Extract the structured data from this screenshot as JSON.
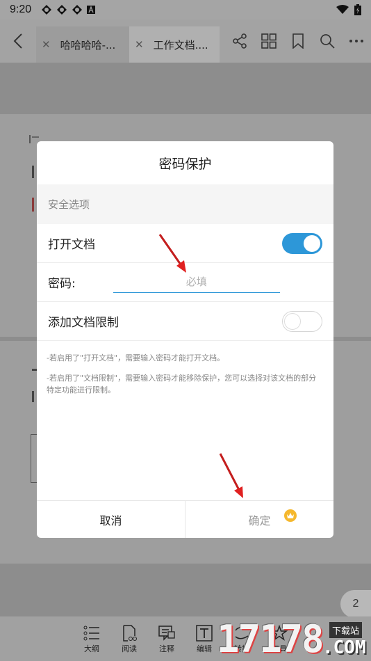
{
  "statusbar": {
    "time": "9:20"
  },
  "toolbar": {
    "tabs": [
      {
        "label": "哈哈哈哈-..."
      },
      {
        "label": "工作文档...."
      }
    ]
  },
  "dialog": {
    "title": "密码保护",
    "section_label": "安全选项",
    "open_doc_label": "打开文档",
    "open_doc_enabled": true,
    "password_label": "密码:",
    "password_placeholder": "必填",
    "password_value": "",
    "restrict_label": "添加文档限制",
    "restrict_enabled": false,
    "note_1": "-若启用了\"打开文档\"，需要输入密码才能打开文档。",
    "note_2": "-若启用了\"文档限制\"，需要输入密码才能移除保护，您可以选择对该文档的部分特定功能进行限制。",
    "cancel_label": "取消",
    "ok_label": "确定"
  },
  "page_indicator": "2",
  "bottombar": {
    "items": [
      {
        "label": "大纲"
      },
      {
        "label": "阅读"
      },
      {
        "label": "注释"
      },
      {
        "label": "编辑"
      },
      {
        "label": "转换"
      },
      {
        "label": "工具"
      }
    ]
  },
  "watermark": {
    "number": "17178",
    "top": "下载站",
    "com": ".COM"
  },
  "colors": {
    "accent": "#2d97d8",
    "arrow": "#e02020",
    "crown": "#f5b82e"
  }
}
